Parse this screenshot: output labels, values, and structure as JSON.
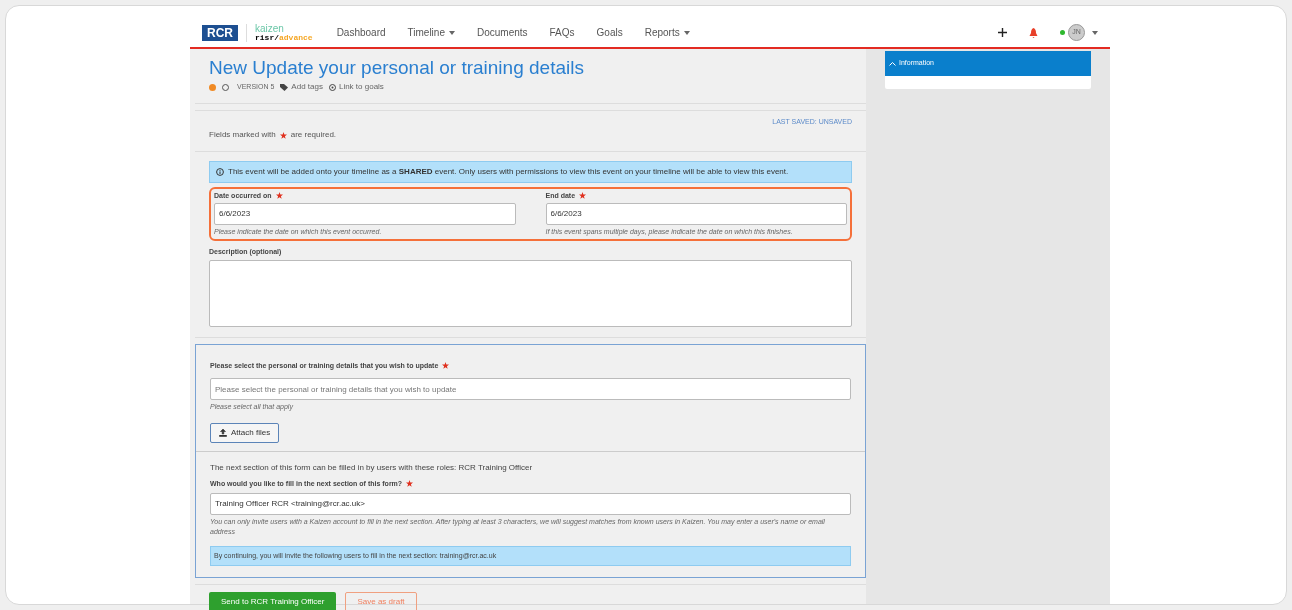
{
  "header": {
    "logo": "RCR",
    "brand_top": "kaizen",
    "brand_bottom_a": "risr/",
    "brand_bottom_b": "advance",
    "nav": [
      {
        "label": "Dashboard",
        "dropdown": false
      },
      {
        "label": "Timeline",
        "dropdown": true
      },
      {
        "label": "Documents",
        "dropdown": false
      },
      {
        "label": "FAQs",
        "dropdown": false
      },
      {
        "label": "Goals",
        "dropdown": false
      },
      {
        "label": "Reports",
        "dropdown": true
      }
    ],
    "avatar": "JN",
    "online": true
  },
  "title": "New Update your personal or training details",
  "meta": {
    "version": "VERSION 5",
    "tags": "Add tags",
    "goals": "Link to goals"
  },
  "required_note_a": "Fields marked with",
  "required_note_b": "are required.",
  "last_saved": "LAST SAVED: UNSAVED",
  "info": {
    "text_a": "This event will be added onto your timeline as a ",
    "bold": "SHARED",
    "text_b": " event. Only users with permissions to view this event on your timeline will be able to view this event."
  },
  "dates": [
    {
      "label": "Date occurred on",
      "required": true,
      "value": "6/6/2023",
      "hint": "Please indicate the date on which this event occurred."
    },
    {
      "label": "End date",
      "required": true,
      "value": "6/6/2023",
      "hint": "If this event spans multiple days, please indicate the date on which this finishes."
    }
  ],
  "description": {
    "label": "Description (optional)"
  },
  "details": {
    "label": "Please select the personal or training details that you wish to update",
    "required": true,
    "placeholder": "Please select the personal or training details that you wish to update",
    "hint": "Please select all that apply"
  },
  "attach": "Attach files",
  "next": {
    "intro": "The next section of this form can be filled in by users with these roles: RCR Training Officer",
    "label": "Who would you like to fill in the next section of this form?",
    "required": true,
    "value": "Training Officer RCR <training@rcr.ac.uk>",
    "hint": "You can only invite users with a Kaizen account to fill in the next section. After typing at least 3 characters, we will suggest matches from known users in Kaizen. You may enter a user's name or email address",
    "notice": "By continuing, you will invite the following users to fill in the next section: training@rcr.ac.uk"
  },
  "buttons": {
    "send": "Send to RCR Training Officer",
    "draft": "Save as draft"
  },
  "sidebar": {
    "title": "Information",
    "expanded": true
  }
}
